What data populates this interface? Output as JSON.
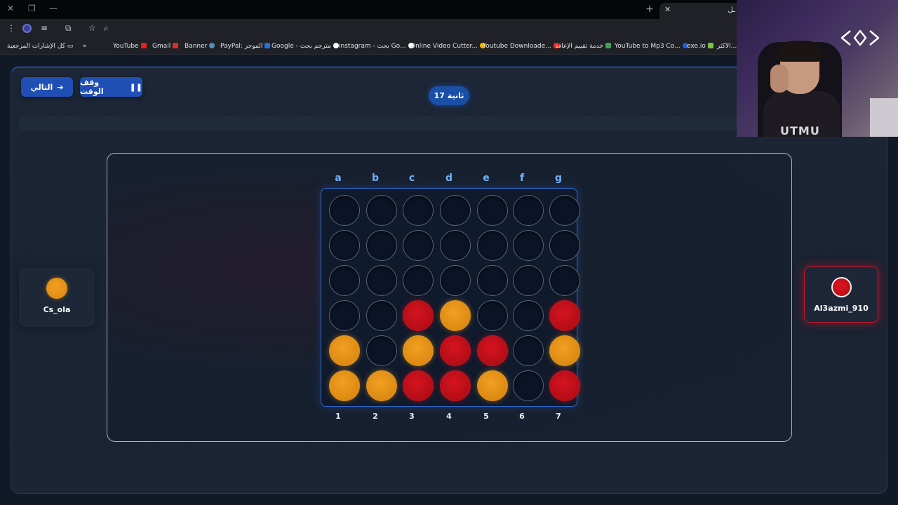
{
  "browser": {
    "tab_title": "ـل",
    "window_controls": {
      "close": "✕",
      "restore": "❐",
      "minimize": "—"
    },
    "new_tab": "+",
    "tab_close": "✕",
    "bookmarks": [
      {
        "label": "كل الإشارات المرجعية"
      },
      {
        "label": "»"
      },
      {
        "label": "YouTube"
      },
      {
        "label": "Gmail"
      },
      {
        "label": "Banner"
      },
      {
        "label": "PayPal: الموجز"
      },
      {
        "label": "Google - مترجم بحث"
      },
      {
        "label": "instagram - بحث Go..."
      },
      {
        "label": "Online Video Cutter..."
      },
      {
        "label": "Youtube Downloade..."
      },
      {
        "label": "خدمة تقييم الإعاقة"
      },
      {
        "label": "YouTube to Mp3 Co..."
      },
      {
        "label": "exe.io"
      },
      {
        "label": "الاكثر..."
      }
    ]
  },
  "game": {
    "next_button": "التالي",
    "pause_button": "وقف الوقت",
    "timer": "17 ثانية",
    "column_letters": [
      "a",
      "b",
      "c",
      "d",
      "e",
      "f",
      "g"
    ],
    "column_numbers": [
      "1",
      "2",
      "3",
      "4",
      "5",
      "6",
      "7"
    ],
    "board": [
      [
        "empty",
        "empty",
        "empty",
        "empty",
        "empty",
        "empty",
        "empty"
      ],
      [
        "empty",
        "empty",
        "empty",
        "empty",
        "empty",
        "empty",
        "empty"
      ],
      [
        "empty",
        "empty",
        "empty",
        "empty",
        "empty",
        "empty",
        "empty"
      ],
      [
        "empty",
        "empty",
        "red",
        "yellow",
        "empty",
        "empty",
        "red"
      ],
      [
        "yellow",
        "empty",
        "yellow",
        "red",
        "red",
        "empty",
        "yellow"
      ],
      [
        "yellow",
        "yellow",
        "red",
        "red",
        "yellow",
        "empty",
        "red"
      ]
    ],
    "player_left": {
      "name": "Cs_ola",
      "color": "yellow"
    },
    "player_right": {
      "name": "Al3azmi_910",
      "color": "red",
      "active": true
    },
    "colors": {
      "red": "#d51420",
      "yellow": "#f1a022",
      "accent": "#1f4fb5"
    }
  },
  "webcam": {
    "shirt_text": "UTMU"
  }
}
